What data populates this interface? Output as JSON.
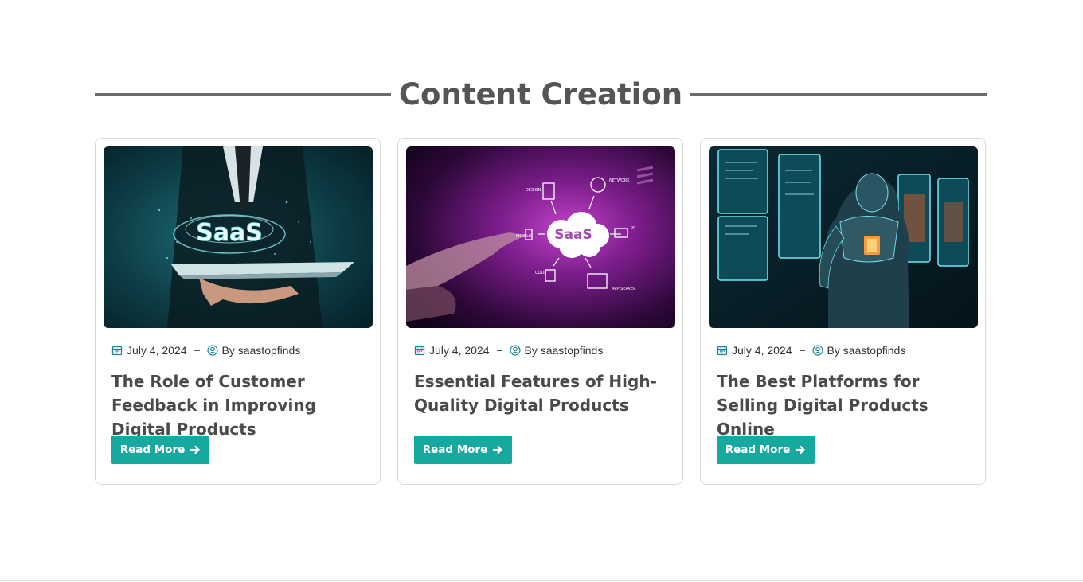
{
  "section": {
    "heading": "Content Creation"
  },
  "posts": [
    {
      "image_icon": "saas-hand-tablet-image",
      "image_text": "SaaS",
      "date": "July 4, 2024",
      "author": "By saastopfinds",
      "title": "The Role of Customer Feedback in Improving Digital Products",
      "button_label": "Read More"
    },
    {
      "image_icon": "saas-cloud-network-image",
      "image_text": "SaaS",
      "date": "July 4, 2024",
      "author": "By saastopfinds",
      "title": "Essential Features of High-Quality Digital Products",
      "button_label": "Read More"
    },
    {
      "image_icon": "robot-screens-image",
      "date": "July 4, 2024",
      "author": "By saastopfinds",
      "title": "The Best Platforms for Selling Digital Products Online",
      "button_label": "Read More"
    }
  ],
  "colors": {
    "accent": "#17a99f",
    "heading": "#555555",
    "icon": "#17849a"
  }
}
